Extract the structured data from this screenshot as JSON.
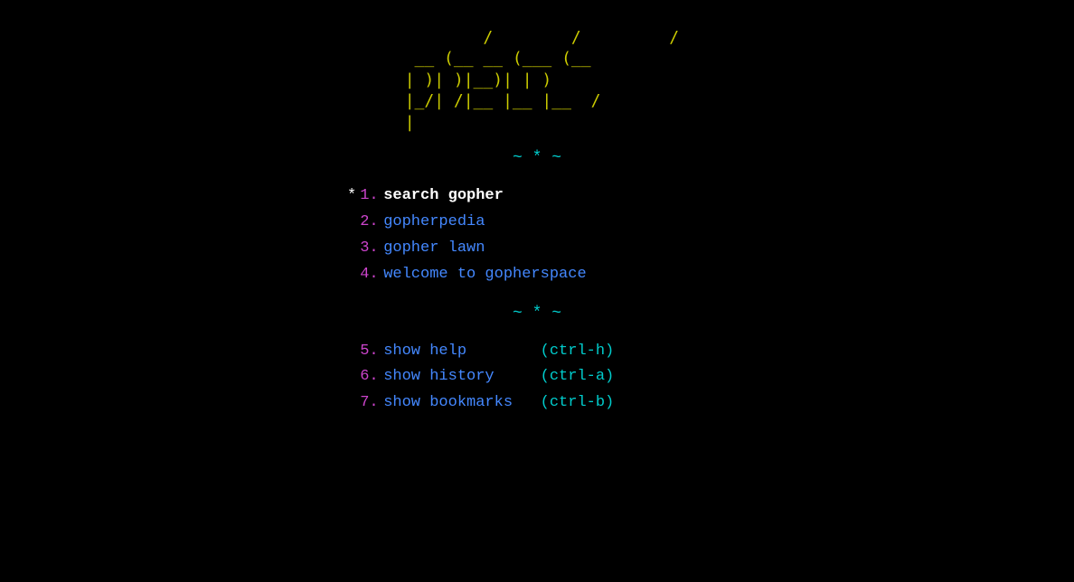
{
  "ascii_art": {
    "lines": [
      "         /        /         /    ",
      "  __ (__ __ (___ (__        ",
      " | )| )|__)| | ) ",
      " |_/| /|__ |__ |__  /    ",
      " |                          "
    ],
    "color": "#cccc00"
  },
  "divider": "~ * ~",
  "menu_items": [
    {
      "cursor": "*",
      "number": "1.",
      "label": "search gopher",
      "shortcut": "",
      "label_color": "white"
    },
    {
      "cursor": " ",
      "number": "2.",
      "label": "gopherpedia",
      "shortcut": "",
      "label_color": "blue"
    },
    {
      "cursor": " ",
      "number": "3.",
      "label": "gopher lawn",
      "shortcut": "",
      "label_color": "blue"
    },
    {
      "cursor": " ",
      "number": "4.",
      "label": "welcome to gopherspace",
      "shortcut": "",
      "label_color": "blue"
    }
  ],
  "menu_items2": [
    {
      "cursor": " ",
      "number": "5.",
      "label": "show help",
      "shortcut": "(ctrl-h)",
      "label_color": "blue"
    },
    {
      "cursor": " ",
      "number": "6.",
      "label": "show history",
      "shortcut": "(ctrl-a)",
      "label_color": "blue"
    },
    {
      "cursor": " ",
      "number": "7.",
      "label": "show bookmarks",
      "shortcut": "(ctrl-b)",
      "label_color": "blue"
    }
  ],
  "number_color": "#cc44cc",
  "label_white_color": "#ffffff",
  "label_blue_color": "#4488ff",
  "shortcut_color": "#00cccc",
  "divider_color": "#00cccc"
}
